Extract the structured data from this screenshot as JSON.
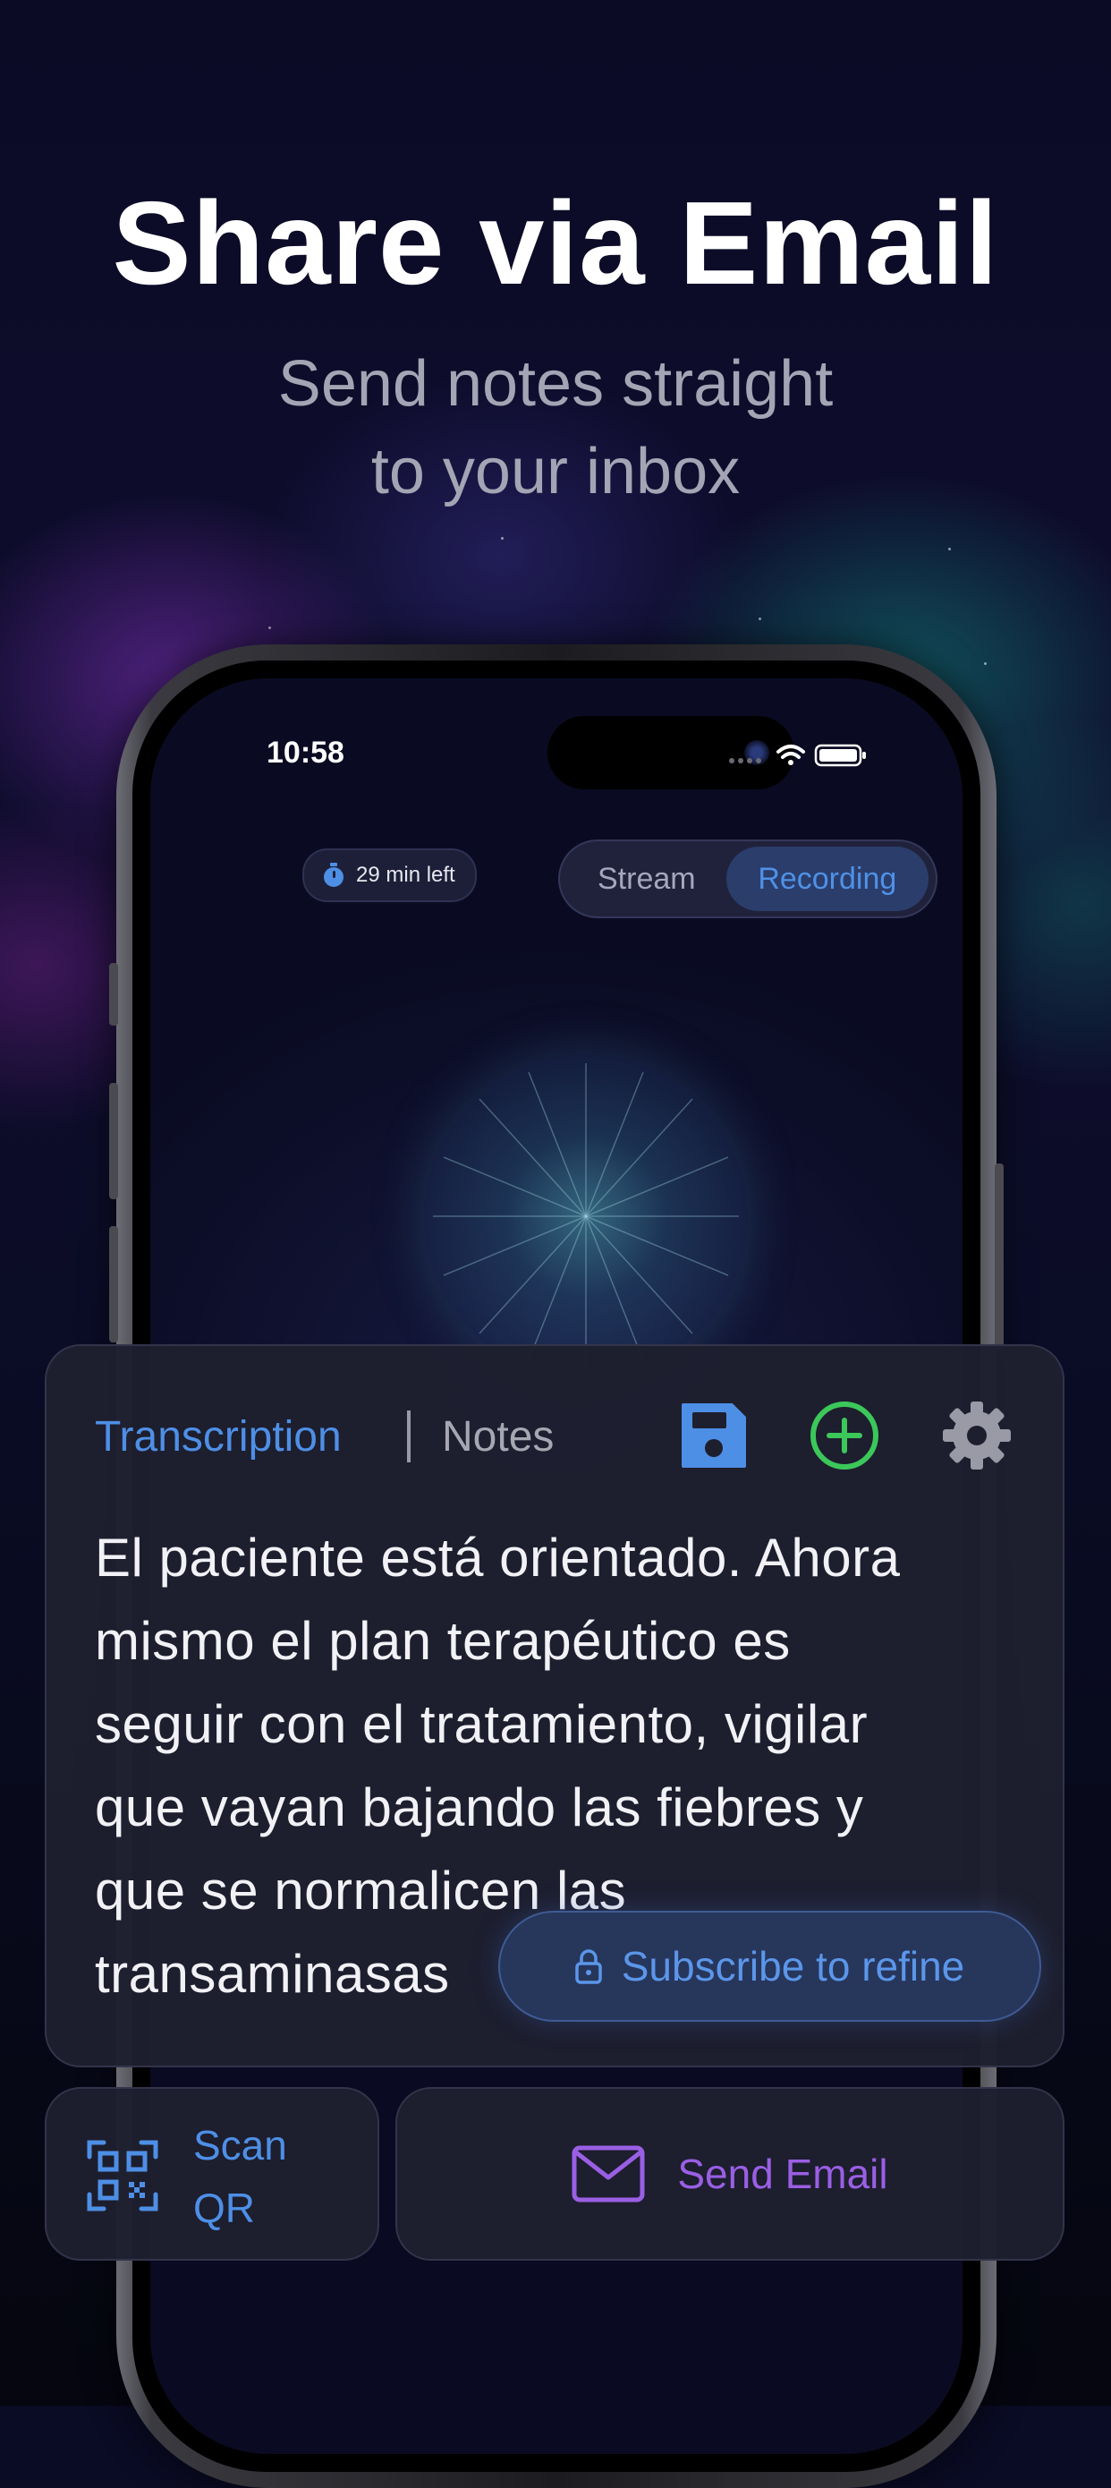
{
  "promo": {
    "headline": "Share via Email",
    "subline_1": "Send notes straight",
    "subline_2": "to your inbox"
  },
  "status_bar": {
    "time": "10:58"
  },
  "top_controls": {
    "timer_text": "29 min left",
    "segments": [
      "Stream",
      "Recording"
    ],
    "selected_segment": "Recording"
  },
  "card": {
    "tabs": [
      "Transcription",
      "Notes"
    ],
    "active_tab": "Transcription",
    "icons": [
      "save-icon",
      "add-circle-icon",
      "gear-icon"
    ],
    "lines": [
      "El paciente está orientado. Ahora",
      "mismo el plan terapéutico es",
      "seguir con el tratamiento, vigilar",
      "que vayan bajando las fiebres y",
      "que se normalicen las",
      "transaminasas"
    ],
    "subscribe_label": "Subscribe to refine"
  },
  "actions": {
    "scan_line_1": "Scan",
    "scan_line_2": "QR",
    "email_label": "Send Email"
  },
  "colors": {
    "accent_blue": "#4e8fe6",
    "accent_green": "#3cc75a",
    "accent_purple": "#9a5fe4"
  }
}
